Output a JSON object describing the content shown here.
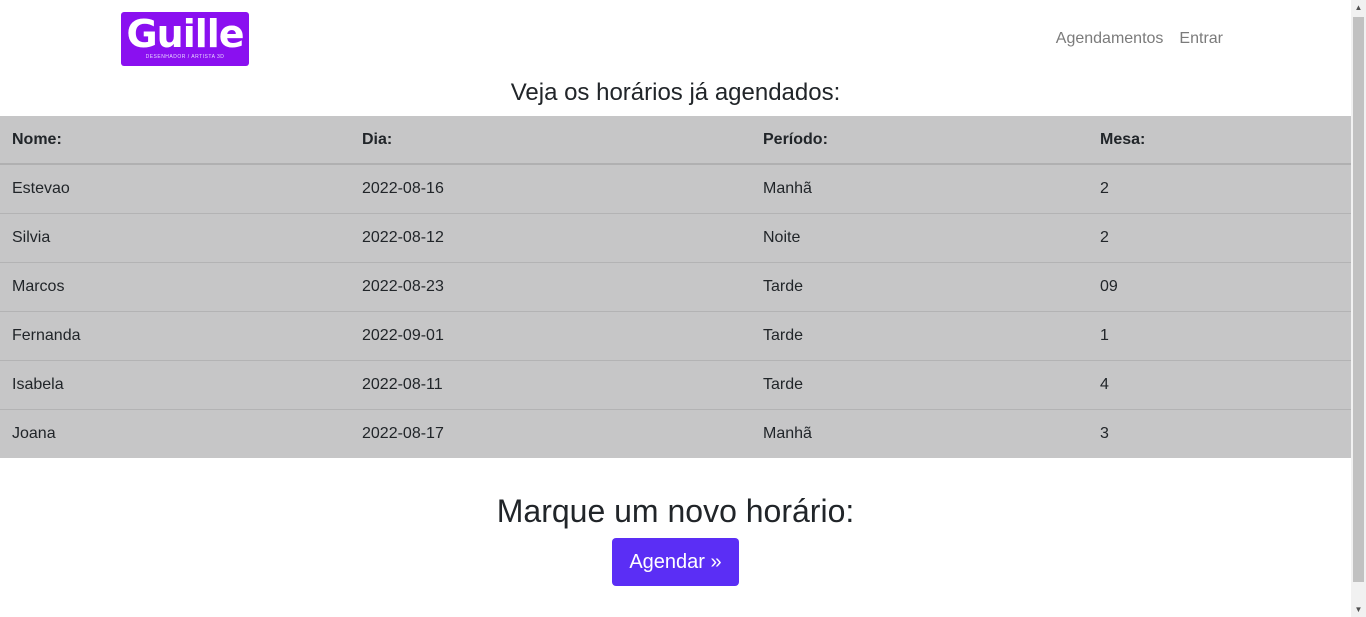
{
  "brand": {
    "logo_text": "Guille",
    "logo_tagline": "DESENHADOR / ARTISTA 3D",
    "logo_color": "#8a10f0"
  },
  "nav": {
    "items": [
      {
        "label": "Agendamentos"
      },
      {
        "label": "Entrar"
      }
    ]
  },
  "schedule": {
    "title": "Veja os horários já agendados:",
    "columns": [
      "Nome:",
      "Dia:",
      "Período:",
      "Mesa:"
    ],
    "rows": [
      {
        "nome": "Estevao",
        "dia": "2022-08-16",
        "periodo": "Manhã",
        "mesa": "2"
      },
      {
        "nome": "Silvia",
        "dia": "2022-08-12",
        "periodo": "Noite",
        "mesa": "2"
      },
      {
        "nome": "Marcos",
        "dia": "2022-08-23",
        "periodo": "Tarde",
        "mesa": "09"
      },
      {
        "nome": "Fernanda",
        "dia": "2022-09-01",
        "periodo": "Tarde",
        "mesa": "1"
      },
      {
        "nome": "Isabela",
        "dia": "2022-08-11",
        "periodo": "Tarde",
        "mesa": "4"
      },
      {
        "nome": "Joana",
        "dia": "2022-08-17",
        "periodo": "Manhã",
        "mesa": "3"
      }
    ],
    "table_bg": "#c6c6c7"
  },
  "cta": {
    "title": "Marque um novo horário:",
    "button_label": "Agendar »",
    "button_color": "#5b2ef5"
  }
}
